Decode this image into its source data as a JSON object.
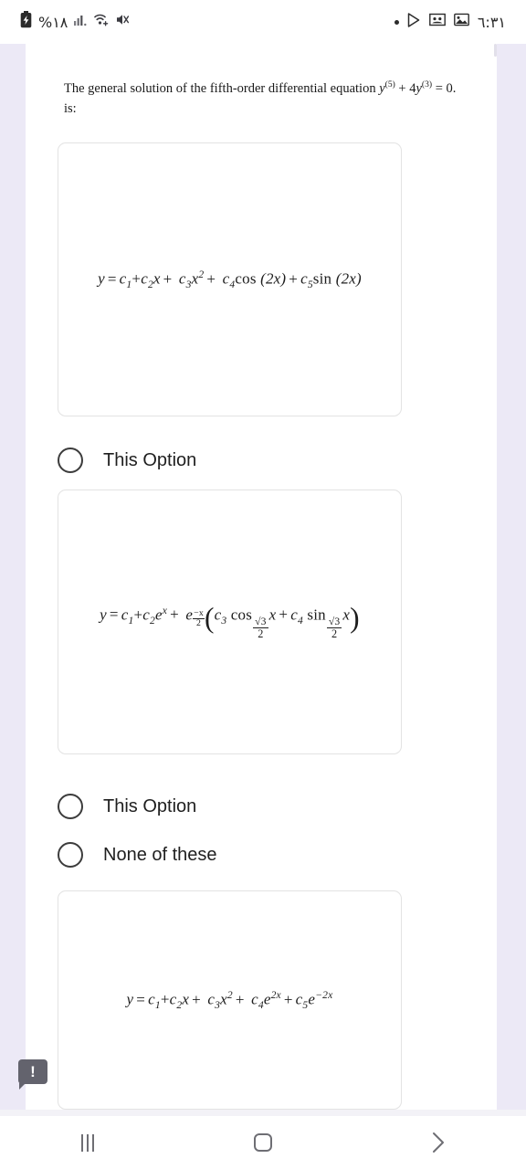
{
  "status_bar": {
    "battery_percent": "%١٨",
    "battery_icon": "battery-charging-icon",
    "signal_icon": "signal-bars-icon",
    "wifi_icon": "wifi-icon",
    "mute_icon": "volume-mute-icon",
    "dot_icon": "dot-indicator-icon",
    "play_icon": "play-store-icon",
    "notification_icon": "notification-badge-icon",
    "image_icon": "image-icon",
    "time": "٦:٣١"
  },
  "question": {
    "prefix": "The general solution of the fifth-order differential equation ",
    "equation_y": "y",
    "equation_sup1": "(5)",
    "equation_plus": " + 4",
    "equation_y2": "y",
    "equation_sup2": "(3)",
    "equation_end": " = 0.",
    "line2": "is:"
  },
  "options": [
    {
      "id": "option-1",
      "formula_plain": "y = c1 + c2 x + c3 x^2 + c4 cos(2x) + c5 sin(2x)",
      "radio_label": "This Option",
      "radio_selected": false
    },
    {
      "id": "option-2",
      "formula_plain": "y = c1 + c2 e^x + e^(-x/2) ( c3 cos(√3/2 x) + c4 sin(√3/2 x) )",
      "radio_label": "This Option",
      "radio_selected": false
    },
    {
      "id": "option-none",
      "radio_label": "None of these",
      "radio_selected": false
    },
    {
      "id": "option-3",
      "formula_plain": "y = c1 + c2 x + c3 x^2 + c4 e^(2x) + c5 e^(-2x)"
    }
  ],
  "formula1": {
    "y": "y",
    "eq": "=",
    "c1": "c",
    "c1s": "1",
    "plus1": "+",
    "c2": "c",
    "c2s": "2",
    "x1": "x",
    "plus2": "+",
    "c3": "c",
    "c3s": "3",
    "x2": "x",
    "x2sup": "2",
    "plus3": "+",
    "c4": "c",
    "c4s": "4",
    "cos": "cos",
    "arg1": "(2x)",
    "plus4": "+",
    "c5": "c",
    "c5s": "5",
    "sin": "sin",
    "arg2": "(2x)"
  },
  "formula2": {
    "y": "y",
    "eq": "=",
    "c1": "c",
    "c1s": "1",
    "plus1": "+",
    "c2": "c",
    "c2s": "2",
    "e1": "e",
    "e1sup": "x",
    "plus2": "+",
    "e2": "e",
    "e2num": "−x",
    "e2den": "2",
    "lparen": "(",
    "c3": "c",
    "c3s": "3",
    "cos": "cos",
    "radnum": "√3",
    "radden": "2",
    "xa": "x",
    "plus3": "+",
    "c4": "c",
    "c4s": "4",
    "sin": "sin",
    "radnum2": "√3",
    "radden2": "2",
    "xb": "x",
    "rparen": ")"
  },
  "formula3": {
    "y": "y",
    "eq": "=",
    "c1": "c",
    "c1s": "1",
    "plus1": "+",
    "c2": "c",
    "c2s": "2",
    "x1": "x",
    "plus2": "+",
    "c3": "c",
    "c3s": "3",
    "x2": "x",
    "x2sup": "2",
    "plus3": "+",
    "c4": "c",
    "c4s": "4",
    "e1": "e",
    "e1sup": "2x",
    "plus4": "+",
    "c5": "c",
    "c5s": "5",
    "e2": "e",
    "e2sup": "−2x"
  },
  "feedback": {
    "glyph": "!",
    "name": "feedback-bubble"
  },
  "navbar": {
    "recents_label": "recent-apps",
    "home_label": "home",
    "back_label": "back"
  },
  "colors": {
    "page_rail": "#ece9f6",
    "card_border": "#e3e3e3",
    "text": "#1d1d1d",
    "feedback_bg": "#63636d",
    "nav_icon": "#6e6e74"
  }
}
